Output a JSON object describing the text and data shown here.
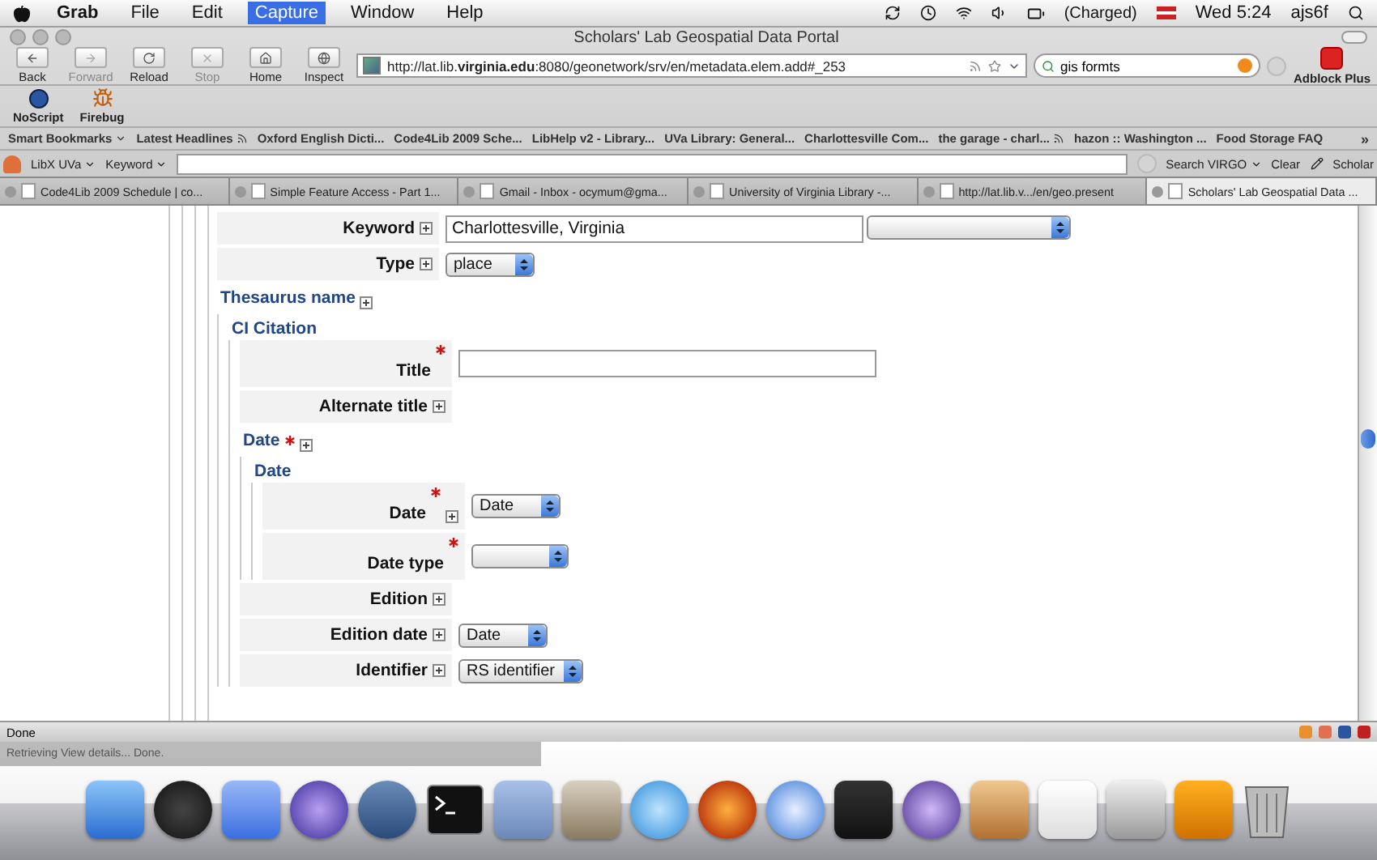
{
  "menu_bar": {
    "items": [
      {
        "label": "Grab",
        "selected": false,
        "kind": "app"
      },
      {
        "label": "File",
        "selected": false,
        "kind": "menu"
      },
      {
        "label": "Edit",
        "selected": false,
        "kind": "menu"
      },
      {
        "label": "Capture",
        "selected": true,
        "kind": "menu"
      },
      {
        "label": "Window",
        "selected": false,
        "kind": "menu"
      },
      {
        "label": "Help",
        "selected": false,
        "kind": "menu"
      }
    ],
    "battery": "(Charged)",
    "clock": "Wed 5:24",
    "user": "ajs6f"
  },
  "window": {
    "title": "Scholars' Lab Geospatial Data Portal"
  },
  "nav_toolbar": {
    "buttons": [
      {
        "label": "Back",
        "disabled": false
      },
      {
        "label": "Forward",
        "disabled": true
      },
      {
        "label": "Reload",
        "disabled": false
      },
      {
        "label": "Stop",
        "disabled": true
      },
      {
        "label": "Home",
        "disabled": false
      },
      {
        "label": "Inspect",
        "disabled": false
      }
    ],
    "url": "http://lat.lib.**virginia.edu**:8080/geonetwork/srv/en/metadata.elem.add#_253",
    "search": "gis formts",
    "addon": "Adblock Plus"
  },
  "addon_toolbar": {
    "buttons": [
      "NoScript",
      "Firebug"
    ]
  },
  "bookmarks": [
    {
      "label": "Smart Bookmarks",
      "kind": "menu"
    },
    {
      "label": "Latest Headlines",
      "kind": "feed"
    },
    {
      "label": "Oxford English Dicti...",
      "kind": "link"
    },
    {
      "label": "Code4Lib 2009 Sche...",
      "kind": "link"
    },
    {
      "label": "LibHelp v2 - Library...",
      "kind": "link"
    },
    {
      "label": "UVa Library: General...",
      "kind": "link"
    },
    {
      "label": "Charlottesville Com...",
      "kind": "link"
    },
    {
      "label": "the garage - charl...",
      "kind": "feed"
    },
    {
      "label": "hazon :: Washington ...",
      "kind": "link"
    },
    {
      "label": "Food Storage FAQ",
      "kind": "link"
    }
  ],
  "bookmarks_overflow": "»",
  "libx": {
    "label": "LibX UVa",
    "field_menu": "Keyword",
    "search_button": "Search VIRGO",
    "clear_button": "Clear",
    "scholar_button": "Scholar"
  },
  "tabs": [
    {
      "label": "Code4Lib 2009 Schedule | co...",
      "selected": false
    },
    {
      "label": "Simple Feature Access - Part 1...",
      "selected": false
    },
    {
      "label": "Gmail - Inbox - ocymum@gma...",
      "selected": false
    },
    {
      "label": "University of Virginia Library -...",
      "selected": false
    },
    {
      "label": "http://lat.lib.v.../en/geo.present",
      "selected": false
    },
    {
      "label": "Scholars' Lab Geospatial Data ...",
      "selected": true
    }
  ],
  "form": {
    "items": [
      {
        "kind": "field",
        "label": "Keyword",
        "required": false,
        "expandable": true,
        "control": {
          "kind": "text_select",
          "value": "Charlottesville, Virginia"
        }
      },
      {
        "kind": "field",
        "label": "Type",
        "required": false,
        "expandable": true,
        "control": {
          "kind": "select",
          "value": "place"
        }
      },
      {
        "kind": "section",
        "label": "Thesaurus name",
        "required": false,
        "expandable": true,
        "children": [
          {
            "kind": "section",
            "label": "CI Citation",
            "required": false,
            "expandable": false,
            "children": [
              {
                "kind": "field",
                "label": "Title",
                "required": true,
                "expandable": false,
                "control": {
                  "kind": "text"
                }
              },
              {
                "kind": "field",
                "label": "Alternate title",
                "required": false,
                "expandable": true
              },
              {
                "kind": "section",
                "label": "Date",
                "required": true,
                "expandable": true,
                "children": [
                  {
                    "kind": "section",
                    "label": "Date",
                    "required": false,
                    "expandable": false,
                    "children": [
                      {
                        "kind": "field",
                        "label": "Date",
                        "required": true,
                        "expandable": true,
                        "control": {
                          "kind": "select",
                          "value": "Date"
                        }
                      },
                      {
                        "kind": "field",
                        "label": "Date type",
                        "required": true,
                        "expandable": false,
                        "control": {
                          "kind": "select"
                        }
                      }
                    ]
                  }
                ]
              },
              {
                "kind": "field",
                "label": "Edition",
                "required": false,
                "expandable": true
              },
              {
                "kind": "field",
                "label": "Edition date",
                "required": false,
                "expandable": true,
                "control": {
                  "kind": "select",
                  "value": "Date"
                }
              },
              {
                "kind": "field",
                "label": "Identifier",
                "required": false,
                "expandable": true,
                "control": {
                  "kind": "select",
                  "value": "RS identifier"
                }
              }
            ]
          }
        ]
      }
    ]
  },
  "status_bar": {
    "text": "Done",
    "message": "Retrieving View details... Done."
  }
}
